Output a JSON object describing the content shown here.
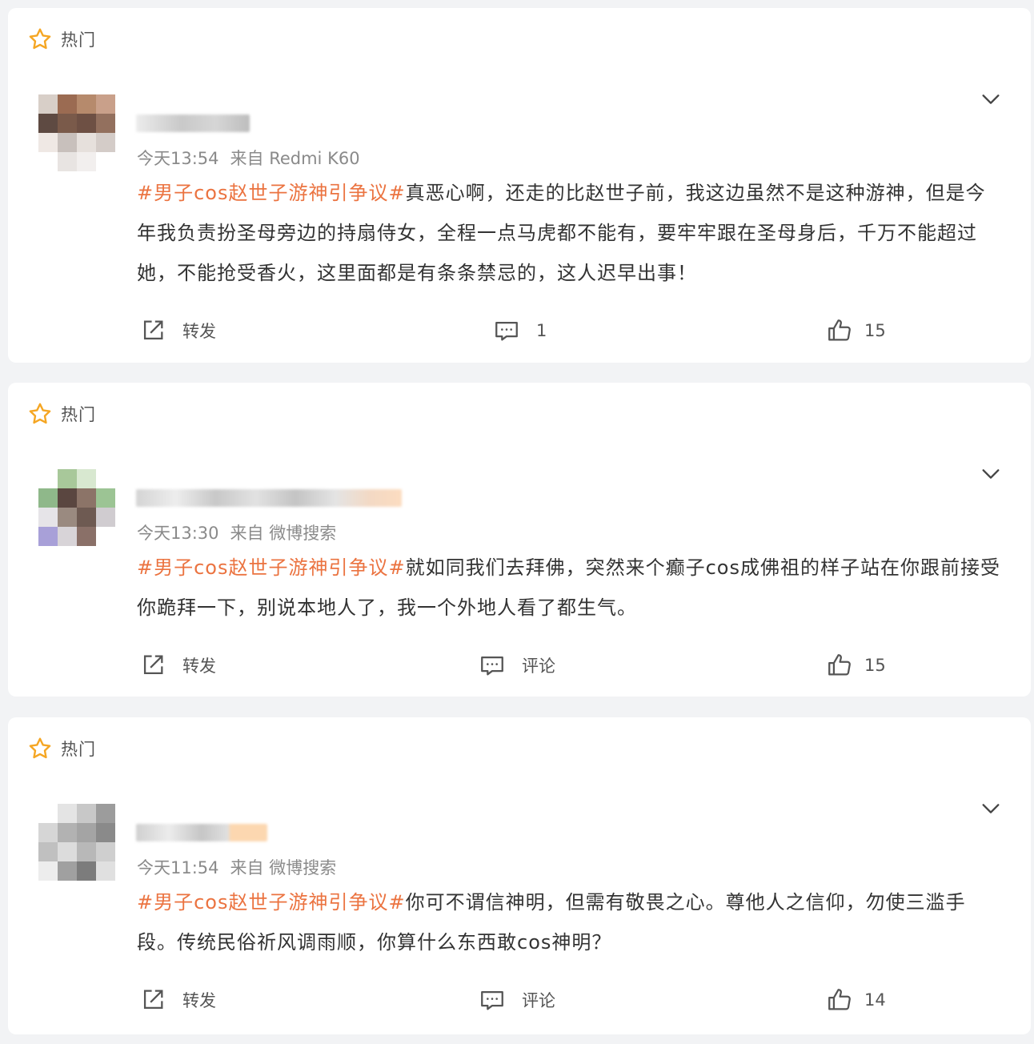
{
  "hot_label": "热门",
  "colors": {
    "tag": "#eb7340",
    "meta": "#8a8a8a",
    "text": "#333333",
    "star": "#f5a623"
  },
  "icons": {
    "hot": "star-icon",
    "collapse": "chevron-down-icon",
    "forward": "share-icon",
    "comment": "comment-icon",
    "like": "thumbs-up-icon"
  },
  "comments": [
    {
      "time": "今天13:54",
      "source": "来自 Redmi K60",
      "hashtag": "#男子cos赵世子游神引争议#",
      "text": "真恶心啊，还走的比赵世子前，我这边虽然不是这种游神，但是今年我负责扮圣母旁边的持扇侍女，全程一点马虎都不能有，要牢牢跟在圣母身后，千万不能超过她，不能抢受香火，这里面都是有条条禁忌的，这人迟早出事！",
      "forward_label": "转发",
      "comment_label": "1",
      "like_count": "15"
    },
    {
      "time": "今天13:30",
      "source": "来自 微博搜索",
      "hashtag": "#男子cos赵世子游神引争议#",
      "text": "就如同我们去拜佛，突然来个癫子cos成佛祖的样子站在你跟前接受你跪拜一下，别说本地人了，我一个外地人看了都生气。",
      "forward_label": "转发",
      "comment_label": "评论",
      "like_count": "15"
    },
    {
      "time": "今天11:54",
      "source": "来自 微博搜索",
      "hashtag": "#男子cos赵世子游神引争议#",
      "text": "你可不谓信神明，但需有敬畏之心。尊他人之信仰，勿使三滥手段。传统民俗祈风调雨顺，你算什么东西敢cos神明？",
      "forward_label": "转发",
      "comment_label": "评论",
      "like_count": "14"
    }
  ]
}
